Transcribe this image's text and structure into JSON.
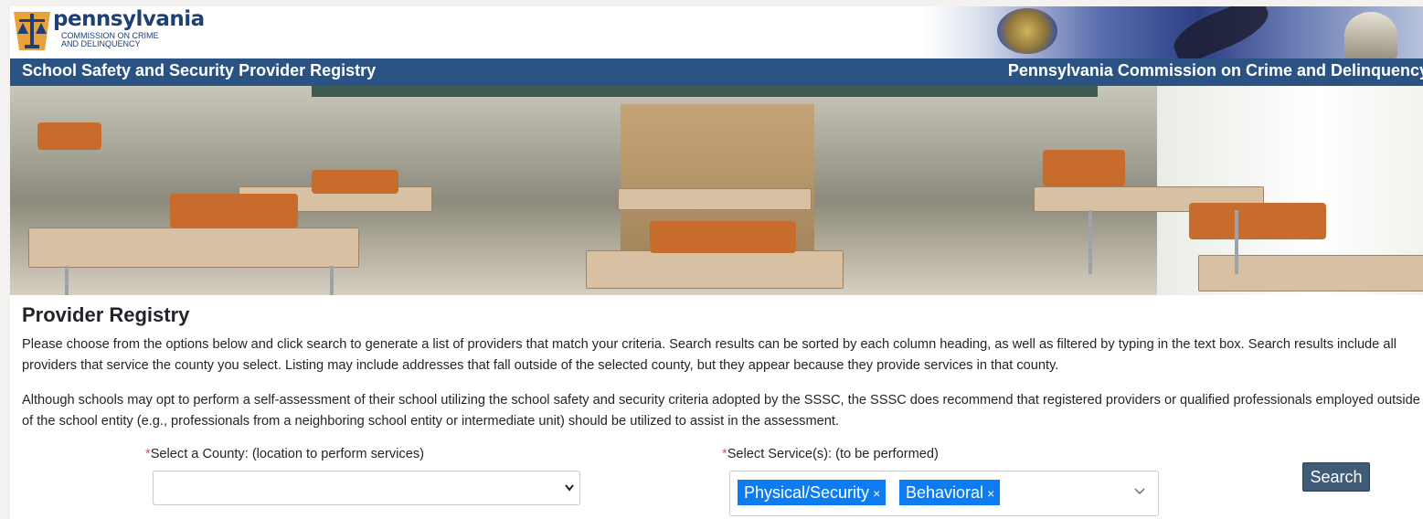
{
  "branding": {
    "logo_word": "pennsylvania",
    "logo_subtitle": "COMMISSION ON CRIME\nAND DELINQUENCY"
  },
  "title_bar": {
    "left": "School Safety and Security Provider Registry",
    "right": "Pennsylvania Commission on Crime and Delinquency"
  },
  "hero": {
    "description": "classroom-photo"
  },
  "main": {
    "heading": "Provider Registry",
    "paragraph1": "Please choose from the options below and click search to generate a list of providers that match your criteria. Search results can be sorted by each column heading, as well as filtered by typing in the text box. Search results include all providers that service the county you select. Listing may include addresses that fall outside of the selected county, but they appear because they provide services in that county.",
    "paragraph2": "Although schools may opt to perform a self-assessment of their school utilizing the school safety and security criteria adopted by the SSSC, the SSSC does recommend that registered providers or qualified professionals employed outside of the school entity (e.g., professionals from a neighboring school entity or intermediate unit) should be utilized to assist in the assessment."
  },
  "form": {
    "required_mark": "*",
    "county_label": "Select a County: (location to perform services)",
    "county_value": "",
    "service_label": "Select Service(s): (to be performed)",
    "selected_services": [
      "Physical/Security",
      "Behavioral"
    ],
    "remove_mark": "×",
    "search_label": "Search"
  },
  "icons": {
    "select_caret": "chevron-down-icon",
    "remove_tag": "close-icon"
  },
  "colors": {
    "title_bar": "#2a5384",
    "tag_bg": "#0d7cf0",
    "search_btn": "#3f5b78",
    "required": "#d9534f"
  }
}
